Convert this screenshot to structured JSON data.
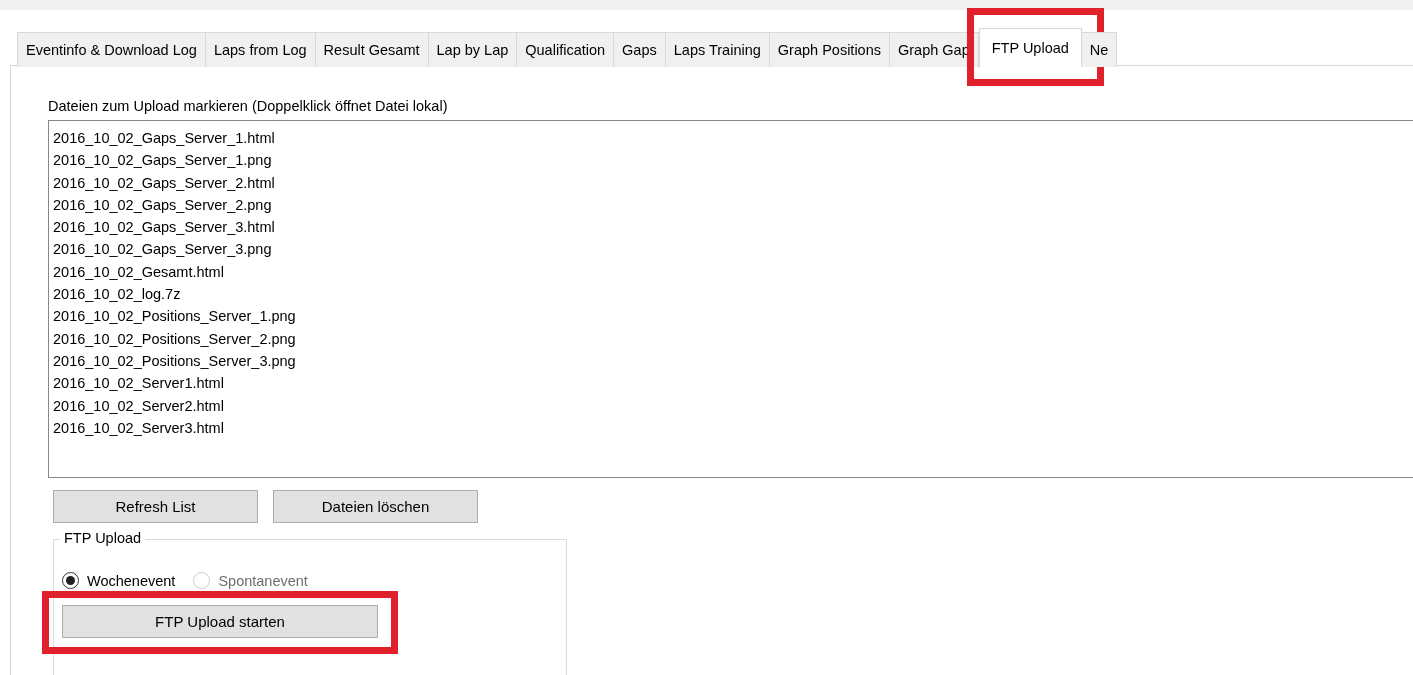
{
  "tabs": [
    {
      "label": "Eventinfo & Download Log",
      "selected": false,
      "highlighted": false
    },
    {
      "label": "Laps from Log",
      "selected": false,
      "highlighted": false
    },
    {
      "label": "Result Gesamt",
      "selected": false,
      "highlighted": false
    },
    {
      "label": "Lap by Lap",
      "selected": false,
      "highlighted": false
    },
    {
      "label": "Qualification",
      "selected": false,
      "highlighted": false
    },
    {
      "label": "Gaps",
      "selected": false,
      "highlighted": false
    },
    {
      "label": "Laps Training",
      "selected": false,
      "highlighted": false
    },
    {
      "label": "Graph Positions",
      "selected": false,
      "highlighted": false
    },
    {
      "label": "Graph Gap",
      "selected": false,
      "highlighted": false
    },
    {
      "label": "FTP Upload",
      "selected": true,
      "highlighted": true
    },
    {
      "label": "Ne",
      "selected": false,
      "highlighted": false
    }
  ],
  "file_list": {
    "label": "Dateien zum Upload markieren (Doppelklick öffnet Datei lokal)",
    "items": [
      "2016_10_02_Gaps_Server_1.html",
      "2016_10_02_Gaps_Server_1.png",
      "2016_10_02_Gaps_Server_2.html",
      "2016_10_02_Gaps_Server_2.png",
      "2016_10_02_Gaps_Server_3.html",
      "2016_10_02_Gaps_Server_3.png",
      "2016_10_02_Gesamt.html",
      "2016_10_02_log.7z",
      "2016_10_02_Positions_Server_1.png",
      "2016_10_02_Positions_Server_2.png",
      "2016_10_02_Positions_Server_3.png",
      "2016_10_02_Server1.html",
      "2016_10_02_Server2.html",
      "2016_10_02_Server3.html"
    ]
  },
  "buttons": [
    "Refresh List",
    "Dateien löschen"
  ],
  "ftp_group": {
    "title": "FTP Upload",
    "radios": [
      {
        "label": "Wochenevent",
        "selected": true,
        "disabled": false
      },
      {
        "label": "Spontanevent",
        "selected": false,
        "disabled": true
      }
    ],
    "button": {
      "label": "FTP Upload starten",
      "highlighted": true
    }
  }
}
